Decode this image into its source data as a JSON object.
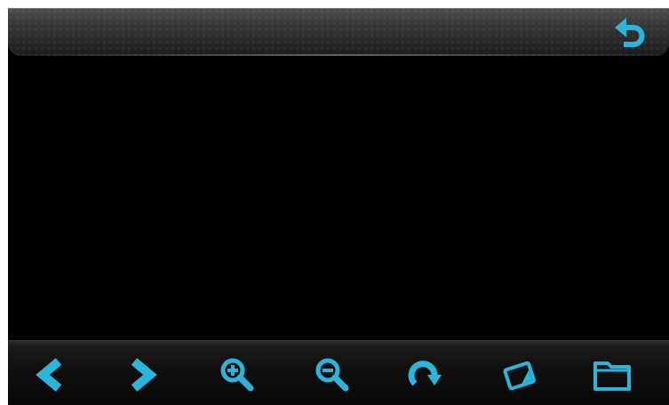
{
  "theme": {
    "accent": "#29b5dc",
    "accent_dark": "#1a86a8",
    "background": "#000000"
  },
  "top_bar": {
    "back_icon": "back-arrow-icon"
  },
  "toolbar": {
    "buttons": [
      {
        "name": "previous",
        "icon": "chevron-left-icon"
      },
      {
        "name": "next",
        "icon": "chevron-right-icon"
      },
      {
        "name": "zoom-in",
        "icon": "zoom-in-icon"
      },
      {
        "name": "zoom-out",
        "icon": "zoom-out-icon"
      },
      {
        "name": "rotate",
        "icon": "rotate-icon"
      },
      {
        "name": "slideshow",
        "icon": "photo-icon"
      },
      {
        "name": "folder",
        "icon": "folder-icon"
      }
    ]
  }
}
